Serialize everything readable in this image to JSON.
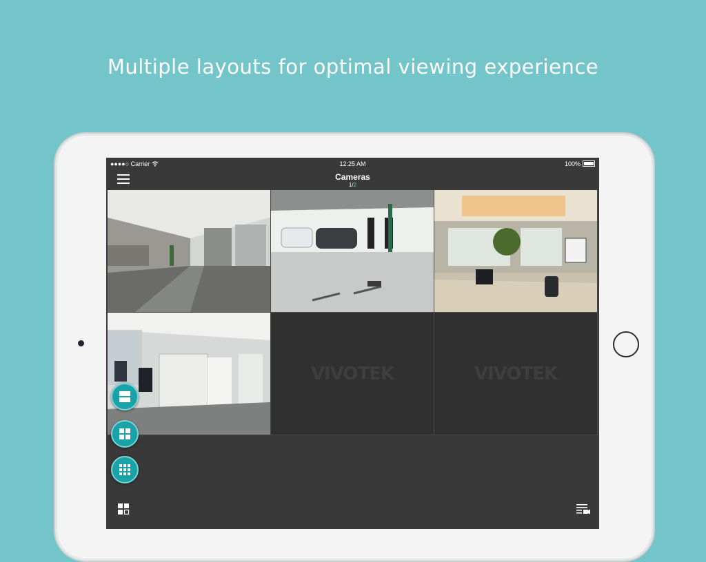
{
  "headline": "Multiple layouts for optimal viewing experience",
  "status": {
    "carrier": "●●●●○ Carrier",
    "time": "12:25 AM",
    "battery": "100%"
  },
  "nav": {
    "title": "Cameras",
    "page_current": "1",
    "page_sep": "/",
    "page_total": "2"
  },
  "cameras": [
    {
      "name": "lobby",
      "logo": ""
    },
    {
      "name": "parking-garage",
      "logo": ""
    },
    {
      "name": "office-room",
      "logo": ""
    },
    {
      "name": "open-office",
      "logo": ""
    },
    {
      "name": "empty-slot",
      "logo": "VIVOTEK"
    },
    {
      "name": "empty-slot",
      "logo": "VIVOTEK"
    }
  ],
  "icons": {
    "menu": "menu-icon",
    "wifi": "wifi-icon",
    "layout_1x2": "layout-1x2-icon",
    "layout_2x2": "layout-2x2-icon",
    "layout_3x3": "layout-3x3-icon",
    "layout_switch": "layout-switch-icon",
    "camera_list": "camera-list-icon"
  },
  "colors": {
    "background": "#74c5ca",
    "accent": "#19a3a8",
    "screen": "#393939"
  }
}
